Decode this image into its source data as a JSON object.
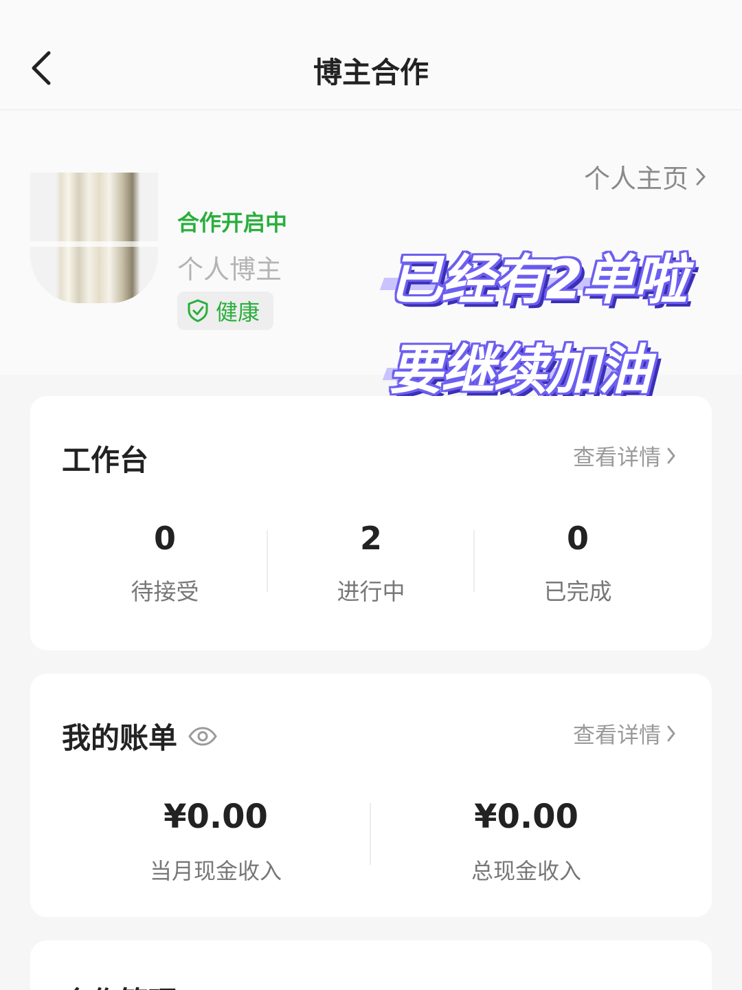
{
  "header": {
    "title": "博主合作"
  },
  "profile": {
    "status": "合作开启中",
    "type": "个人博主",
    "health": "健康",
    "homepage_link": "个人主页"
  },
  "sticker": {
    "line1": "已经有2单啦",
    "line2": "要继续加油"
  },
  "workbench": {
    "title": "工作台",
    "detail_link": "查看详情",
    "stats": [
      {
        "value": "0",
        "label": "待接受"
      },
      {
        "value": "2",
        "label": "进行中"
      },
      {
        "value": "0",
        "label": "已完成"
      }
    ]
  },
  "bill": {
    "title": "我的账单",
    "detail_link": "查看详情",
    "items": [
      {
        "value": "¥0.00",
        "label": "当月现金收入"
      },
      {
        "value": "¥0.00",
        "label": "总现金收入"
      }
    ]
  },
  "management": {
    "title": "合作管理"
  },
  "colors": {
    "accent_green": "#2aae3c",
    "sticker_purple": "#6d5ff0"
  }
}
